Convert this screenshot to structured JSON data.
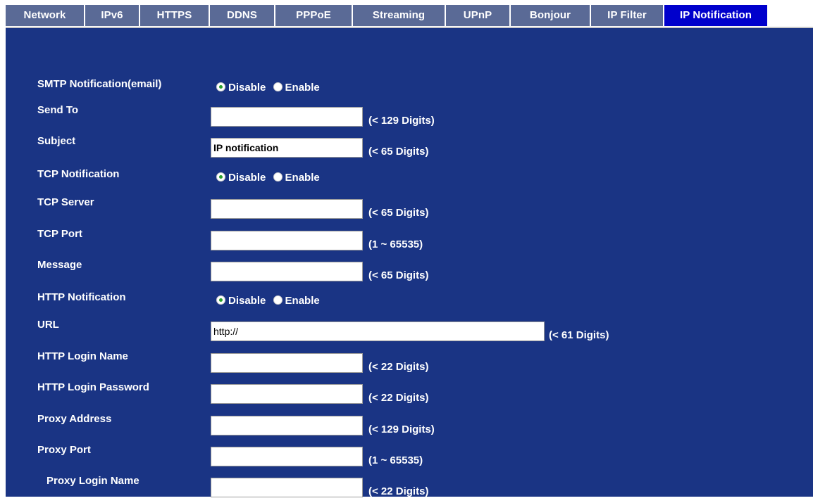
{
  "tabs": [
    {
      "label": "Network",
      "active": false
    },
    {
      "label": "IPv6",
      "active": false
    },
    {
      "label": "HTTPS",
      "active": false
    },
    {
      "label": "DDNS",
      "active": false
    },
    {
      "label": "PPPoE",
      "active": false
    },
    {
      "label": "Streaming",
      "active": false
    },
    {
      "label": "UPnP",
      "active": false
    },
    {
      "label": "Bonjour",
      "active": false
    },
    {
      "label": "IP Filter",
      "active": false
    },
    {
      "label": "IP Notification",
      "active": true
    }
  ],
  "radio_labels": {
    "disable": "Disable",
    "enable": "Enable"
  },
  "form": {
    "smtp": {
      "label": "SMTP Notification(email)",
      "selected": "Disable"
    },
    "send_to": {
      "label": "Send To",
      "value": "",
      "hint": "(< 129 Digits)"
    },
    "subject": {
      "label": "Subject",
      "value": "IP notification",
      "hint": "(< 65 Digits)"
    },
    "tcp": {
      "label": "TCP Notification",
      "selected": "Disable"
    },
    "tcp_server": {
      "label": "TCP Server",
      "value": "",
      "hint": "(< 65 Digits)"
    },
    "tcp_port": {
      "label": "TCP Port",
      "value": "",
      "hint": "(1 ~ 65535)"
    },
    "message": {
      "label": "Message",
      "value": "",
      "hint": "(< 65 Digits)"
    },
    "http": {
      "label": "HTTP Notification",
      "selected": "Disable"
    },
    "url": {
      "label": "URL",
      "value": "http://",
      "hint": "(< 61 Digits)"
    },
    "http_login_name": {
      "label": "HTTP Login Name",
      "value": "",
      "hint": "(< 22 Digits)"
    },
    "http_login_password": {
      "label": "HTTP Login Password",
      "value": "",
      "hint": "(< 22 Digits)"
    },
    "proxy_address": {
      "label": "Proxy Address",
      "value": "",
      "hint": "(< 129 Digits)"
    },
    "proxy_port": {
      "label": "Proxy Port",
      "value": "",
      "hint": "(1 ~ 65535)"
    },
    "proxy_login_name": {
      "label": "Proxy Login Name",
      "value": "",
      "hint": "(< 22 Digits)"
    }
  }
}
